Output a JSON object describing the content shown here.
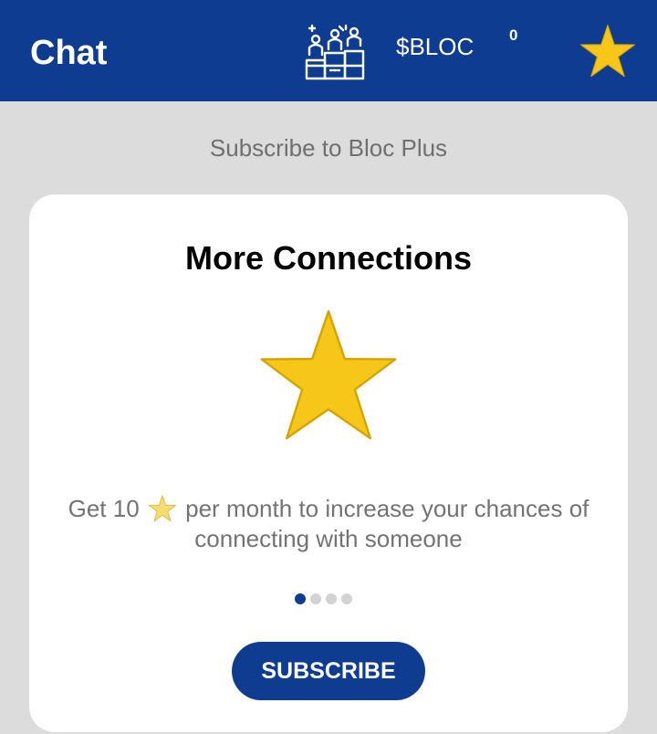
{
  "header": {
    "title": "Chat",
    "currency_label": "$BLOC",
    "star_count": "0",
    "leaderboard_icon": "podium-icon",
    "star_icon": "star-icon"
  },
  "subscribe_heading": "Subscribe to Bloc Plus",
  "card": {
    "title": "More Connections",
    "feature_icon": "star-icon",
    "description_prefix": "Get 10",
    "description_suffix": "per month to increase your chances of connecting with someone",
    "carousel": {
      "total": 4,
      "active_index": 0
    },
    "button_label": "SUBSCRIBE"
  },
  "colors": {
    "brand_blue": "#0d3c91",
    "star_yellow": "#f6c718",
    "background": "#dcdcdc",
    "card": "#ffffff"
  }
}
